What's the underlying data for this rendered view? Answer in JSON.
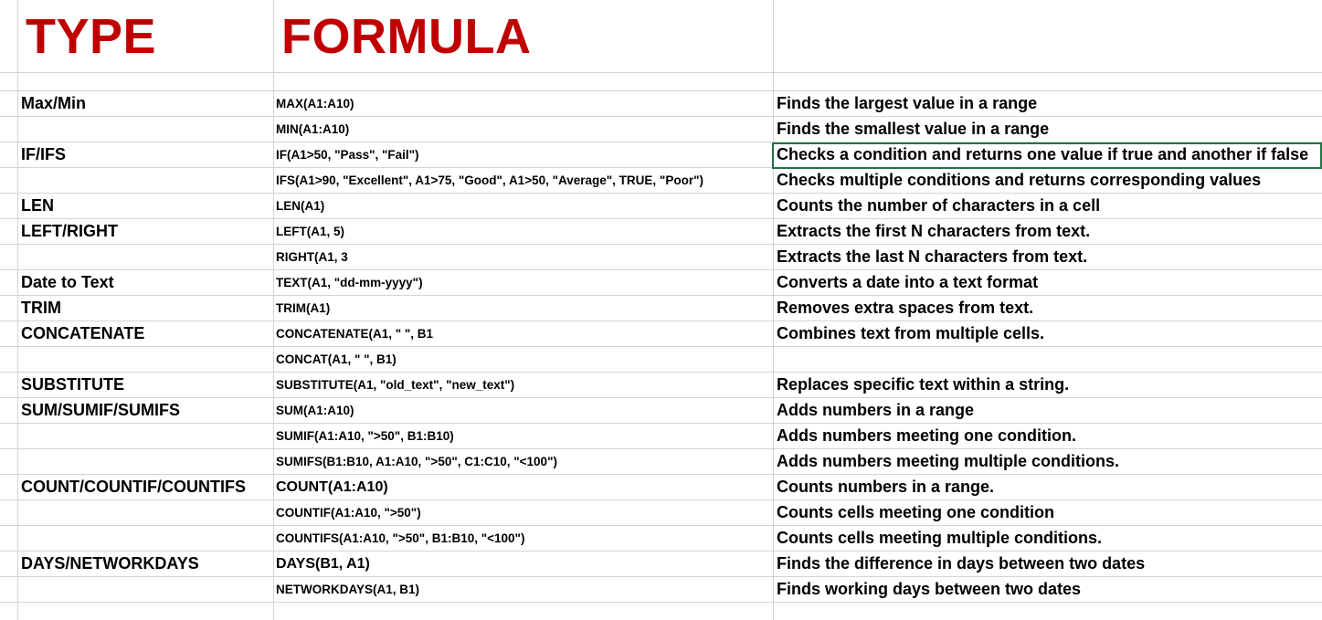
{
  "headers": {
    "type": "TYPE",
    "formula": "FORMULA",
    "description": ""
  },
  "colors": {
    "header_red": "#c00000",
    "selection_green": "#217346",
    "gridline": "#d4d4d4"
  },
  "rows": [
    {
      "type": "Max/Min",
      "formula": "MAX(A1:A10)",
      "description": "Finds the largest value in a range"
    },
    {
      "type": "",
      "formula": "MIN(A1:A10)",
      "description": "Finds the smallest value in a range"
    },
    {
      "type": "IF/IFS",
      "formula": "IF(A1>50, \"Pass\", \"Fail\")",
      "description": "Checks a condition and returns one value if true and another if false"
    },
    {
      "type": "",
      "formula": "IFS(A1>90, \"Excellent\", A1>75, \"Good\", A1>50, \"Average\", TRUE, \"Poor\")",
      "description": "Checks multiple conditions and returns corresponding values"
    },
    {
      "type": "LEN",
      "formula": "LEN(A1)",
      "description": "Counts the number of characters in a cell"
    },
    {
      "type": "LEFT/RIGHT",
      "formula": "LEFT(A1, 5)",
      "description": "Extracts the first N characters from text."
    },
    {
      "type": "",
      "formula": "RIGHT(A1, 3",
      "description": "Extracts the last N characters from text."
    },
    {
      "type": "Date to Text",
      "formula": "TEXT(A1, \"dd-mm-yyyy\")",
      "description": "Converts a date into a text format"
    },
    {
      "type": "TRIM",
      "formula": "TRIM(A1)",
      "description": "Removes extra spaces from text."
    },
    {
      "type": "CONCATENATE",
      "formula": "CONCATENATE(A1, \" \", B1",
      "description": "Combines text from multiple cells."
    },
    {
      "type": "",
      "formula": "CONCAT(A1, \" \", B1)",
      "description": ""
    },
    {
      "type": "SUBSTITUTE",
      "formula": "SUBSTITUTE(A1, \"old_text\", \"new_text\")",
      "description": "Replaces specific text within a string."
    },
    {
      "type": "SUM/SUMIF/SUMIFS",
      "formula": "SUM(A1:A10)",
      "description": "Adds numbers in a range"
    },
    {
      "type": "",
      "formula": "SUMIF(A1:A10, \">50\", B1:B10)",
      "description": "Adds numbers meeting one condition."
    },
    {
      "type": "",
      "formula": "SUMIFS(B1:B10, A1:A10, \">50\", C1:C10, \"<100\")",
      "description": "Adds numbers meeting multiple conditions."
    },
    {
      "type": "COUNT/COUNTIF/COUNTIFS",
      "formula": "COUNT(A1:A10)",
      "description": "Counts numbers in a range."
    },
    {
      "type": "",
      "formula": "COUNTIF(A1:A10, \">50\")",
      "description": "Counts cells meeting one condition"
    },
    {
      "type": "",
      "formula": "COUNTIFS(A1:A10, \">50\", B1:B10, \"<100\")",
      "description": "Counts cells meeting multiple conditions."
    },
    {
      "type": "DAYS/NETWORKDAYS",
      "formula": "DAYS(B1, A1)",
      "description": "Finds the difference in days between two dates"
    },
    {
      "type": "",
      "formula": "NETWORKDAYS(A1, B1)",
      "description": "Finds working days between two dates"
    }
  ]
}
